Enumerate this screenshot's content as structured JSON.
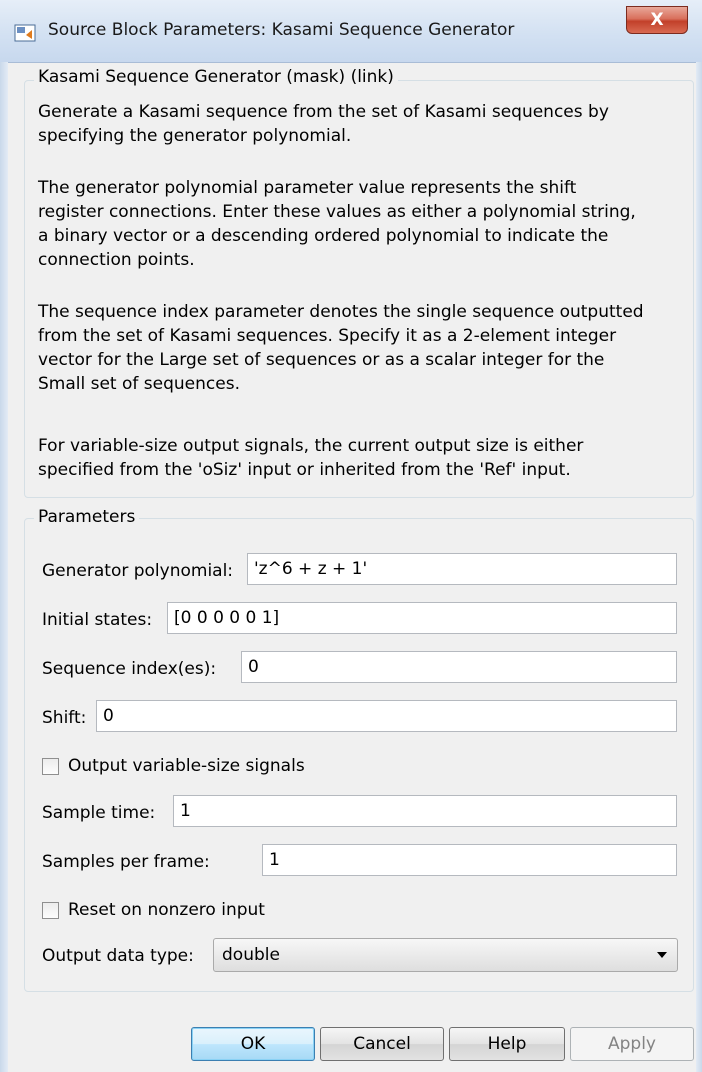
{
  "window": {
    "title": "Source Block Parameters: Kasami Sequence Generator",
    "close_label": "X",
    "app_icon": "simulink-block-icon"
  },
  "description": {
    "group_title": "Kasami Sequence Generator (mask) (link)",
    "paragraphs": [
      [
        "Generate a Kasami sequence from the set of Kasami sequences by",
        "specifying the generator polynomial."
      ],
      [
        "The generator polynomial parameter value represents the shift",
        "register connections. Enter these values as either a polynomial string,",
        "a binary vector or a descending ordered polynomial to indicate the",
        "connection points."
      ],
      [
        "The sequence index parameter denotes the single sequence outputted",
        "from the set of Kasami sequences. Specify it as a 2-element integer",
        "vector for the Large set of sequences or as a scalar integer for the",
        "Small set of sequences."
      ],
      [
        "For variable-size output signals, the current output size is either",
        "specified from the 'oSiz' input or inherited from the 'Ref' input."
      ]
    ]
  },
  "parameters": {
    "group_title": "Parameters",
    "generator_polynomial": {
      "label": "Generator polynomial:",
      "value": "'z^6 + z + 1'"
    },
    "initial_states": {
      "label": "Initial states:",
      "value": "[0 0 0 0 0 1]"
    },
    "sequence_index": {
      "label": "Sequence index(es):",
      "value": "0"
    },
    "shift": {
      "label": "Shift:",
      "value": "0"
    },
    "output_variable_size": {
      "label": "Output variable-size signals",
      "checked": false
    },
    "sample_time": {
      "label": "Sample time:",
      "value": "1"
    },
    "samples_per_frame": {
      "label": "Samples per frame:",
      "value": "1"
    },
    "reset_on_nonzero": {
      "label": "Reset on nonzero input",
      "checked": false
    },
    "output_data_type": {
      "label": "Output data type:",
      "value": "double"
    }
  },
  "buttons": {
    "ok": "OK",
    "cancel": "Cancel",
    "help": "Help",
    "apply": "Apply"
  },
  "colors": {
    "dialog_background": "#f0f0f0",
    "default_button_border": "#3c7fb1",
    "close_button": "#c2402a"
  }
}
